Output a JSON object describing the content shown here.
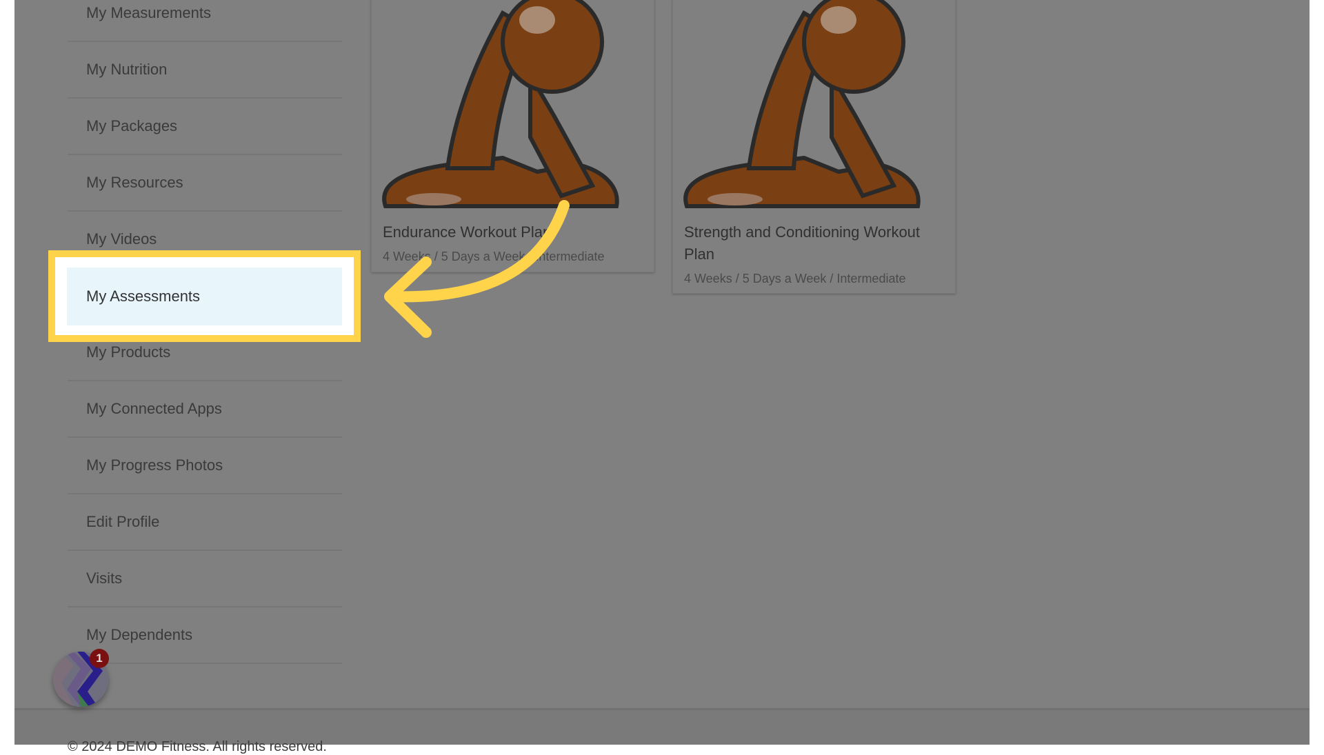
{
  "sidebar": {
    "items": [
      {
        "label": "My Measurements"
      },
      {
        "label": "My Nutrition"
      },
      {
        "label": "My Packages"
      },
      {
        "label": "My Resources"
      },
      {
        "label": "My Videos"
      },
      {
        "label": "My Assessments",
        "highlighted": true
      },
      {
        "label": "My Products"
      },
      {
        "label": "My Connected Apps"
      },
      {
        "label": "My Progress Photos"
      },
      {
        "label": "Edit Profile"
      },
      {
        "label": "Visits"
      },
      {
        "label": "My Dependents"
      }
    ]
  },
  "cards": [
    {
      "title": "Endurance Workout Plan",
      "subtitle": "4 Weeks / 5 Days a Week / Intermediate"
    },
    {
      "title": "Strength and Conditioning Workout Plan",
      "subtitle": "4 Weeks / 5 Days a Week / Intermediate"
    }
  ],
  "widget": {
    "badge_count": "1",
    "icon": "chat-widget-icon"
  },
  "footer": {
    "text": "© 2024 DEMO Fitness. All rights reserved."
  },
  "colors": {
    "highlight": "#ffd34a",
    "overlay": "#808080",
    "selected_bg": "#e8f6fc"
  }
}
